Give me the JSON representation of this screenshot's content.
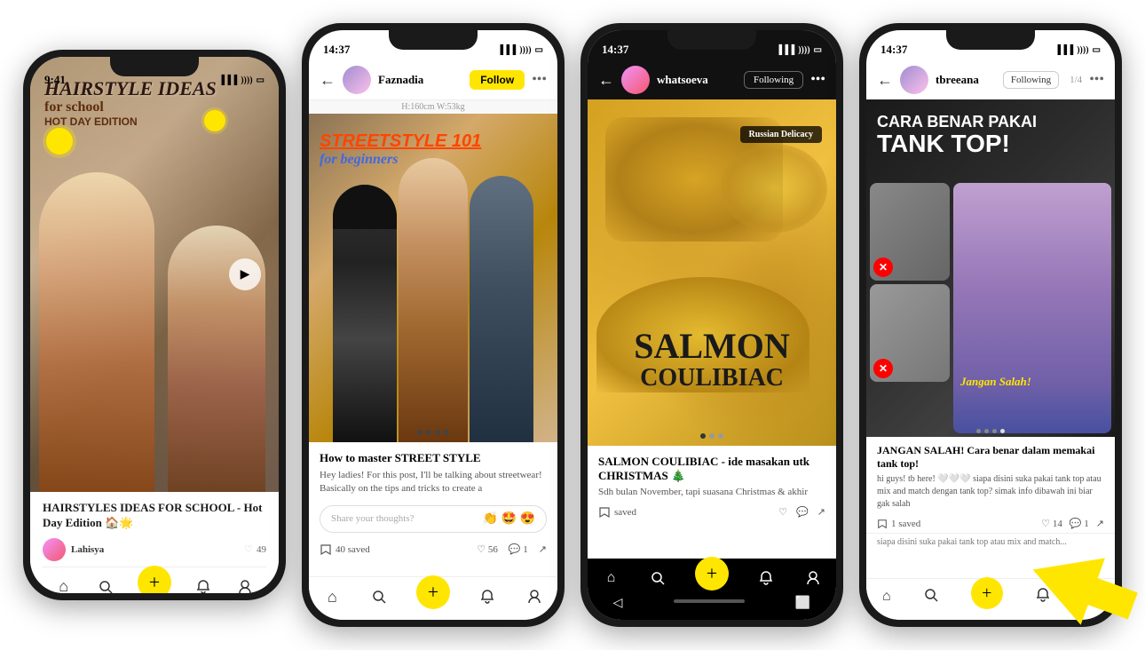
{
  "phone1": {
    "status": {
      "time": "9:41",
      "icons": "▐▐▐ ))) ⬜"
    },
    "hero": {
      "title_line1": "HAIRSTYLE IDEAS",
      "title_line2": "for school",
      "title_line3": "HOT DAY EDITION"
    },
    "post_title": "HAIRSTYLES IDEAS FOR SCHOOL - Hot Day Edition 🏠🌟",
    "author": "Lahisya",
    "likes": "49",
    "nav": {
      "home": "⌂",
      "search": "🔍",
      "plus": "+",
      "bell": "🔔",
      "person": "👤"
    }
  },
  "phone2": {
    "status": {
      "time": "14:37",
      "icons": "▐▐▐ ))) ⬜"
    },
    "header": {
      "username": "Faznadia",
      "follow_label": "Follow",
      "height_weight": "H:160cm W:53kg"
    },
    "hero": {
      "line1": "STREETSTYLE 101",
      "line2": "for beginners"
    },
    "caption_title": "How to master STREET STYLE",
    "caption_body": "Hey ladies! For this post, I'll be talking about streetwear! Basically on the tips and tricks to create a",
    "comment_placeholder": "Share your thoughts?",
    "emoji_row": "👏 🤩 😍",
    "saved_count": "40 saved",
    "likes_count": "56",
    "comments_count": "1"
  },
  "phone3": {
    "status": {
      "time": "14:37",
      "icons": "▐▐▐ ))) ⬜"
    },
    "header": {
      "username": "whatsoeva",
      "following_label": "Following"
    },
    "hero": {
      "russian_badge": "Russian Delicacy",
      "salmon_line1": "SALMON",
      "salmon_line2": "COULIBIAC"
    },
    "caption_title": "SALMON COULIBIAC - ide masakan utk CHRISTMAS 🎄",
    "caption_body": "Sdh bulan November, tapi suasana Christmas & akhir",
    "nav": {
      "home": "⌂",
      "search": "🔍",
      "plus": "+",
      "bell": "🔔",
      "person": "👤"
    }
  },
  "phone4": {
    "status": {
      "time": "14:37",
      "icons": "▐▐▐ ))) ⬜"
    },
    "header": {
      "username": "tbreeana",
      "following_label": "Following",
      "counter": "1/4"
    },
    "hero": {
      "title_line1": "CARA BENAR PAKAI",
      "title_line2": "TANK TOP!",
      "jangan_text": "Jangan Salah!"
    },
    "caption_title": "JANGAN SALAH! Cara benar dalam memakai tank top!",
    "caption_body": "hi guys! tb here! 🤍🤍🤍\nsiapa disini suka pakai tank top atau mix and match dengan tank top? simak info dibawah ini biar gak salah",
    "saved_count": "1 saved",
    "likes_count": "14",
    "comments_count": "1"
  }
}
